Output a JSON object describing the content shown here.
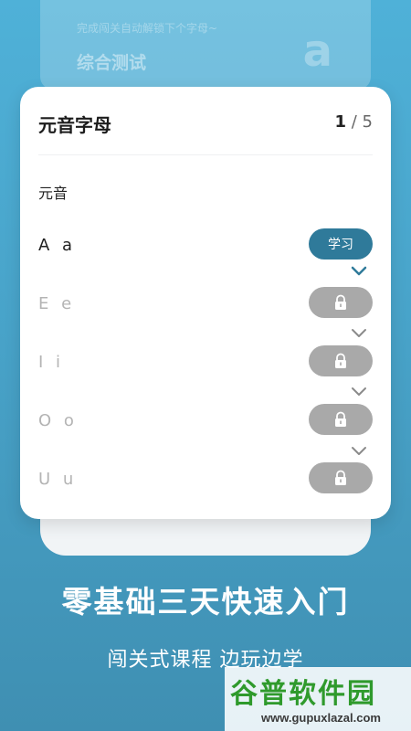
{
  "background_card": {
    "hint": "完成闯关自动解锁下个字母~",
    "title": "综合测试",
    "big_letter": "a"
  },
  "card": {
    "title": "元音字母",
    "progress_current": "1",
    "progress_separator": "/",
    "progress_total": "5",
    "section_label": "元音",
    "rows": [
      {
        "letter": "A a",
        "status": "learn",
        "button_label": "学习",
        "icon": ""
      },
      {
        "letter": "E e",
        "status": "locked",
        "button_label": "",
        "icon": "lock-icon"
      },
      {
        "letter": "I i",
        "status": "locked",
        "button_label": "",
        "icon": "lock-icon"
      },
      {
        "letter": "O o",
        "status": "locked",
        "button_label": "",
        "icon": "lock-icon"
      },
      {
        "letter": "U u",
        "status": "locked",
        "button_label": "",
        "icon": "lock-icon"
      }
    ]
  },
  "promo": {
    "headline": "零基础三天快速入门",
    "subline": "闯关式课程 边玩边学"
  },
  "watermark": {
    "logo": "谷普软件园",
    "url": "www.gupuxlazal.com"
  },
  "colors": {
    "background": "#4aa8cf",
    "learn_button": "#2f7a9a",
    "locked_button": "#a9a9a9",
    "chevron_active": "#2f7a9a",
    "chevron_inactive": "#8a8a8a"
  }
}
